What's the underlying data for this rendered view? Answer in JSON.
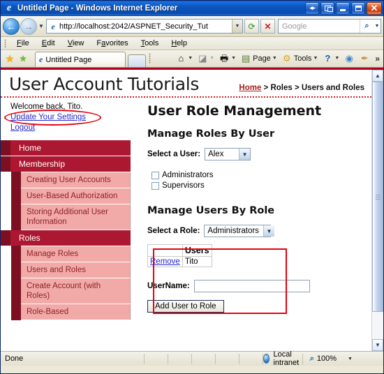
{
  "window": {
    "title": "Untitled Page - Windows Internet Explorer",
    "icon": "ie-logo-icon",
    "buttons": {
      "dual": "dual-window-button",
      "restore_tabs": "restore-button",
      "minimize": "minimize-button",
      "maximize": "maximize-button",
      "close": "✕"
    }
  },
  "navbar": {
    "back": "back-button",
    "forward": "forward-button",
    "recent_dropdown": "▼",
    "url": "http://localhost:2042/ASPNET_Security_Tut",
    "url_dropdown": "▼",
    "refresh": "refresh-button",
    "stop": "✕",
    "search_placeholder": "Google",
    "search_go": "search-go-icon",
    "search_dropdown": "▼"
  },
  "menubar": {
    "items": [
      {
        "label": "File",
        "accel": "F"
      },
      {
        "label": "Edit",
        "accel": "E"
      },
      {
        "label": "View",
        "accel": "V"
      },
      {
        "label": "Favorites",
        "accel": "a"
      },
      {
        "label": "Tools",
        "accel": "T"
      },
      {
        "label": "Help",
        "accel": "H"
      }
    ]
  },
  "tabbar": {
    "favorites_center": "★",
    "add_favorite": "★",
    "tab_label": "Untitled Page",
    "new_tab": "new-tab-button",
    "commands": [
      {
        "name": "home",
        "glyph": "⌂",
        "label": "",
        "caret": "▼"
      },
      {
        "name": "feeds",
        "glyph": "◪",
        "label": "",
        "caret": "▾"
      },
      {
        "name": "print",
        "glyph": "🖶",
        "label": "",
        "caret": "▼"
      },
      {
        "name": "page",
        "glyph": "▤",
        "label": "Page",
        "caret": "▼"
      },
      {
        "name": "tools",
        "glyph": "⚙",
        "label": "Tools",
        "caret": "▼"
      },
      {
        "name": "help",
        "glyph": "?",
        "label": "",
        "caret": "▼"
      },
      {
        "name": "messenger",
        "glyph": "◉",
        "label": "",
        "caret": ""
      },
      {
        "name": "research",
        "glyph": "✒",
        "label": "",
        "caret": ""
      }
    ],
    "overflow": "»"
  },
  "page": {
    "site_title": "User Account Tutorials",
    "breadcrumb": {
      "home": "Home",
      "rest": " > Roles > Users and Roles"
    },
    "sidebar": {
      "welcome": "Welcome back, Tito.",
      "links": [
        "Update Your Settings",
        "Logout"
      ],
      "nav": [
        {
          "type": "section",
          "label": "Home"
        },
        {
          "type": "section",
          "label": "Membership"
        },
        {
          "type": "sub",
          "label": "Creating User Accounts"
        },
        {
          "type": "sub",
          "label": "User-Based Authorization"
        },
        {
          "type": "sub",
          "label": "Storing Additional User Information"
        },
        {
          "type": "section",
          "label": "Roles"
        },
        {
          "type": "sub",
          "label": "Manage Roles"
        },
        {
          "type": "sub",
          "label": "Users and Roles"
        },
        {
          "type": "sub",
          "label": "Create Account (with Roles)"
        },
        {
          "type": "sub",
          "label": "Role-Based"
        }
      ]
    },
    "main": {
      "heading": "User Role Management",
      "section_user": {
        "heading": "Manage Roles By User",
        "select_label": "Select a User:",
        "selected_user": "Alex",
        "dropdown_caret": "▼",
        "roles": [
          {
            "label": "Administrators",
            "checked": false
          },
          {
            "label": "Supervisors",
            "checked": false
          }
        ]
      },
      "section_role": {
        "heading": "Manage Users By Role",
        "select_label": "Select a Role:",
        "selected_role": "Administrators",
        "dropdown_caret": "▼",
        "table": {
          "columns": [
            "",
            "Users"
          ],
          "rows": [
            {
              "action": "Remove",
              "user": "Tito"
            }
          ]
        },
        "username_label": "UserName:",
        "username_value": "",
        "add_button": "Add User to Role"
      }
    }
  },
  "statusbar": {
    "status": "Done",
    "zone": "Local intranet",
    "zoom": "100%",
    "zoom_caret": "▼"
  },
  "scrollbar": {
    "up": "▲",
    "down": "▼"
  },
  "colors": {
    "accent_red": "#ac1831",
    "accent_dark_red": "#7c1022",
    "sub_pink": "#f2aaa8",
    "annotation": "#e8000d",
    "link_blue": "#2727d0",
    "crumb_link": "#a4211d"
  }
}
